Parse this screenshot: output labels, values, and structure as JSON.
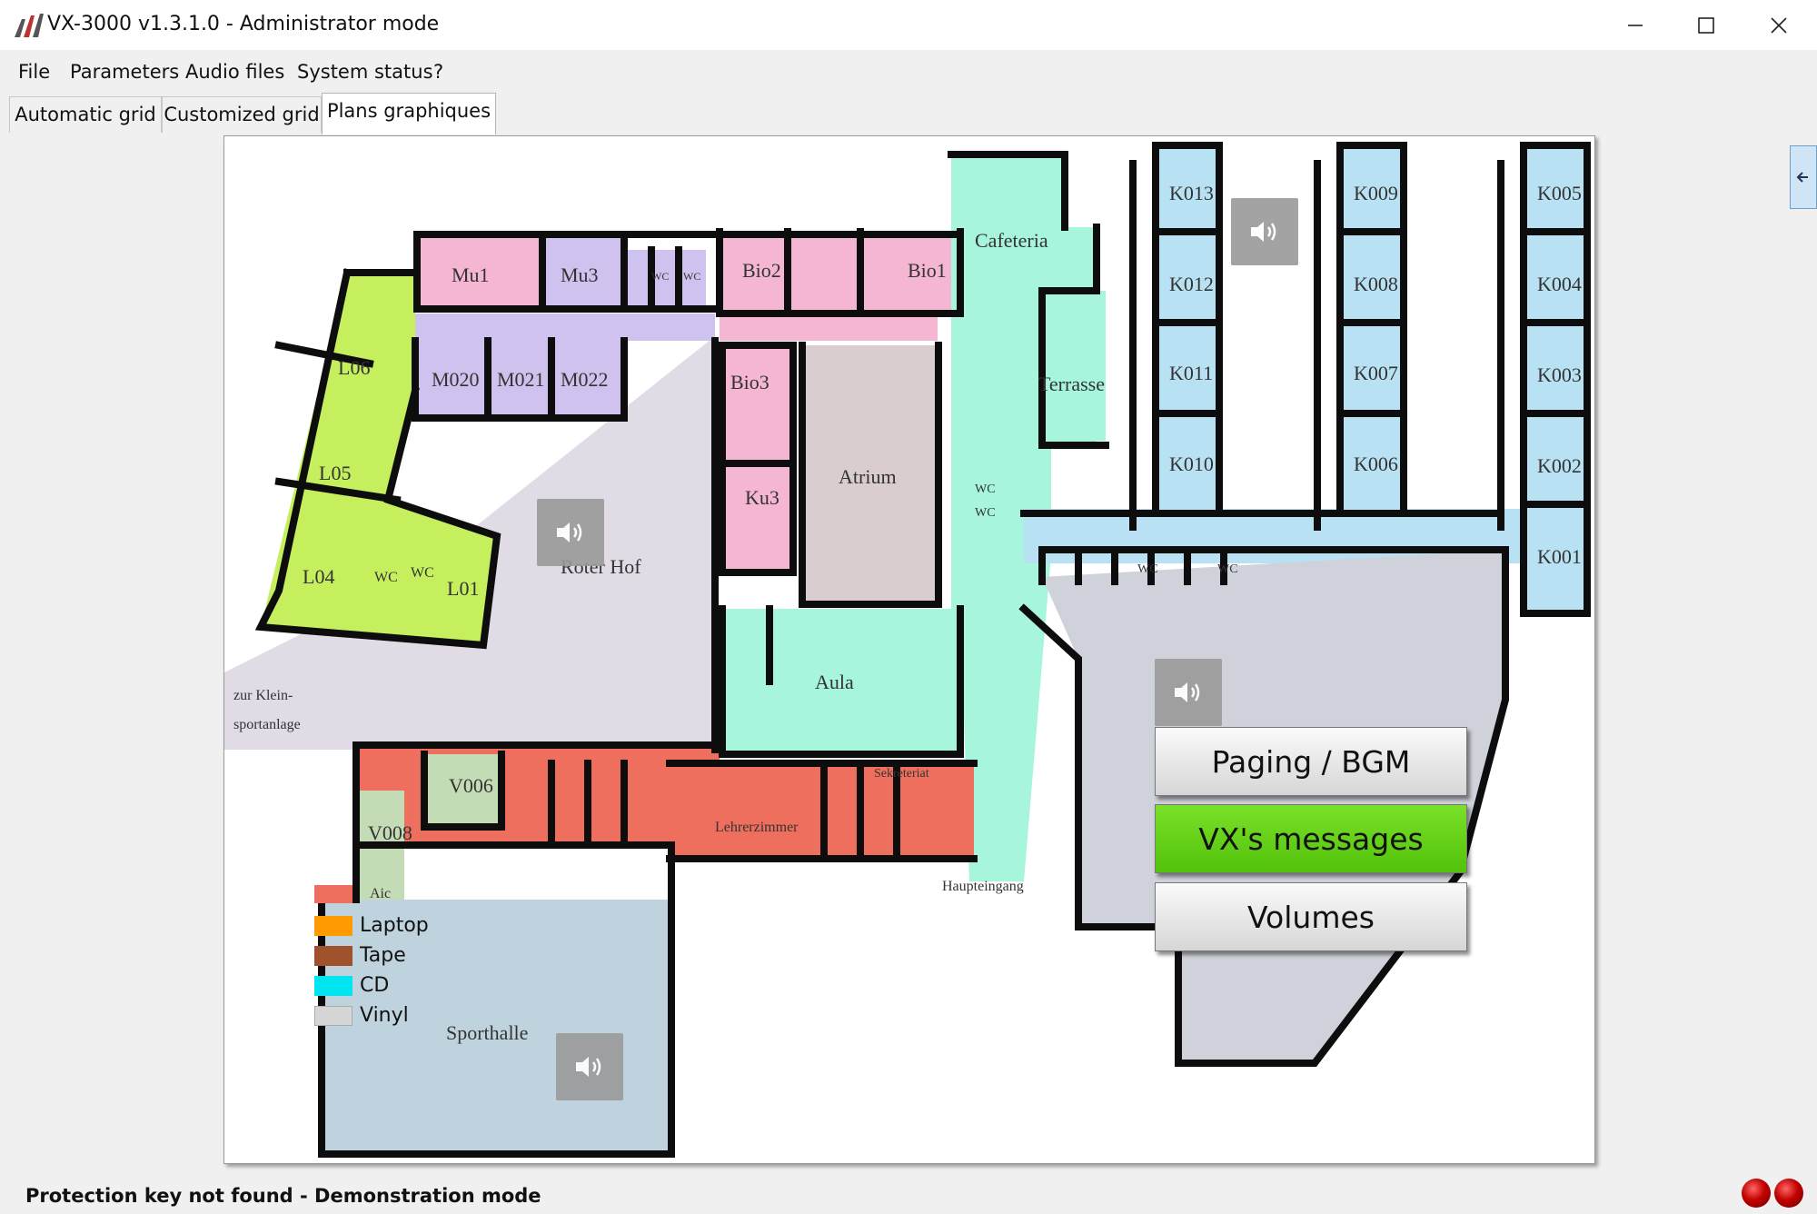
{
  "window": {
    "title": "VX-3000 v1.3.1.0 - Administrator mode",
    "controls": [
      "minimize-icon",
      "maximize-icon",
      "close-icon"
    ]
  },
  "menu": {
    "items": [
      {
        "label": "File"
      },
      {
        "label": "Parameters"
      },
      {
        "label": "Audio files"
      },
      {
        "label": "System status"
      },
      {
        "label": "?"
      }
    ]
  },
  "tabs": [
    {
      "label": "Automatic grid",
      "active": false
    },
    {
      "label": "Customized grid",
      "active": false
    },
    {
      "label": "Plans graphiques",
      "active": true
    }
  ],
  "plan": {
    "rooms": {
      "mu1": "Mu1",
      "mu3": "Mu3",
      "wc_a": "WC",
      "wc_b": "WC",
      "bio2": "Bio2",
      "bio1": "Bio1",
      "cafeteria": "Cafeteria",
      "l06": "L06",
      "l05": "L05",
      "l04": "L04",
      "wc_c": "WC",
      "wc_d": "WC",
      "l01": "L01",
      "m020": "M020",
      "m021": "M021",
      "m022": "M022",
      "bio3": "Bio3",
      "ku3": "Ku3",
      "atrium": "Atrium",
      "terrasse": "Terrasse",
      "wc_e": "WC",
      "wc_f": "WC",
      "roter_hof": "Roter Hof",
      "aula": "Aula",
      "k013": "K013",
      "k012": "K012",
      "k011": "K011",
      "k010": "K010",
      "k009": "K009",
      "k008": "K008",
      "k007": "K007",
      "k006": "K006",
      "k005": "K005",
      "k004": "K004",
      "k003": "K003",
      "k002": "K002",
      "k001": "K001",
      "wc_g": "WC",
      "wc_h": "WC",
      "zur_klein_1": "zur Klein-",
      "zur_klein_2": "sportanlage",
      "v006": "V006",
      "v008": "V008",
      "sekreteriat": "Sekreteriat",
      "lehrerzimmer": "Lehrerzimmer",
      "haupteingang": "Haupteingang",
      "sporthalle": "Sporthalle",
      "aic": "Aic"
    },
    "zone_colors": {
      "music": "#f4b6d2",
      "purple": "#cfc2ee",
      "lime": "#c6ef5e",
      "mint": "#a6f5dc",
      "lightblue": "#b8e1f4",
      "gray": "#cfd2da",
      "salmon": "#ef6f5e",
      "sage": "#c3dcb6",
      "hof": "#e1dbe6",
      "atrium": "#d9cdd0",
      "sport": "#bfd3de"
    },
    "speaker_icon": "speaker-icon"
  },
  "legend": [
    {
      "label": "Laptop",
      "color": "#ff9a00"
    },
    {
      "label": "Tape",
      "color": "#a0522d"
    },
    {
      "label": "CD",
      "color": "#00e5f0"
    },
    {
      "label": "Vinyl",
      "color": "#d6d6d6"
    }
  ],
  "buttons": {
    "paging": "Paging / BGM",
    "vx_messages": "VX's messages",
    "volumes": "Volumes",
    "colors": {
      "green": "#5ccf12",
      "gray": "#e6e6e6"
    }
  },
  "side_panel": {
    "icon": "arrow-left-icon"
  },
  "status": {
    "text": "Protection key not found - Demonstration mode",
    "indicator_color": "#c20000"
  }
}
